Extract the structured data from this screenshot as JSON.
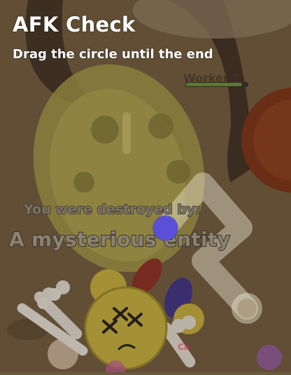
{
  "afk_check": {
    "title": "AFK Check",
    "instruction": "Drag the circle until the end"
  },
  "death_screen": {
    "destroyed_by_label": "You were destroyed by:",
    "killer_name": "A mysterious entity"
  },
  "background": {
    "player_name_fragment": "Worker T",
    "mob_name_tag": "Ca"
  },
  "icons": {
    "drag_handle": "circle-handle-icon",
    "player": "dead-flower-icon"
  },
  "colors": {
    "drag_circle": "#5a4fd6",
    "title_text": "#ffffff",
    "killer_text": "#8a8273"
  }
}
